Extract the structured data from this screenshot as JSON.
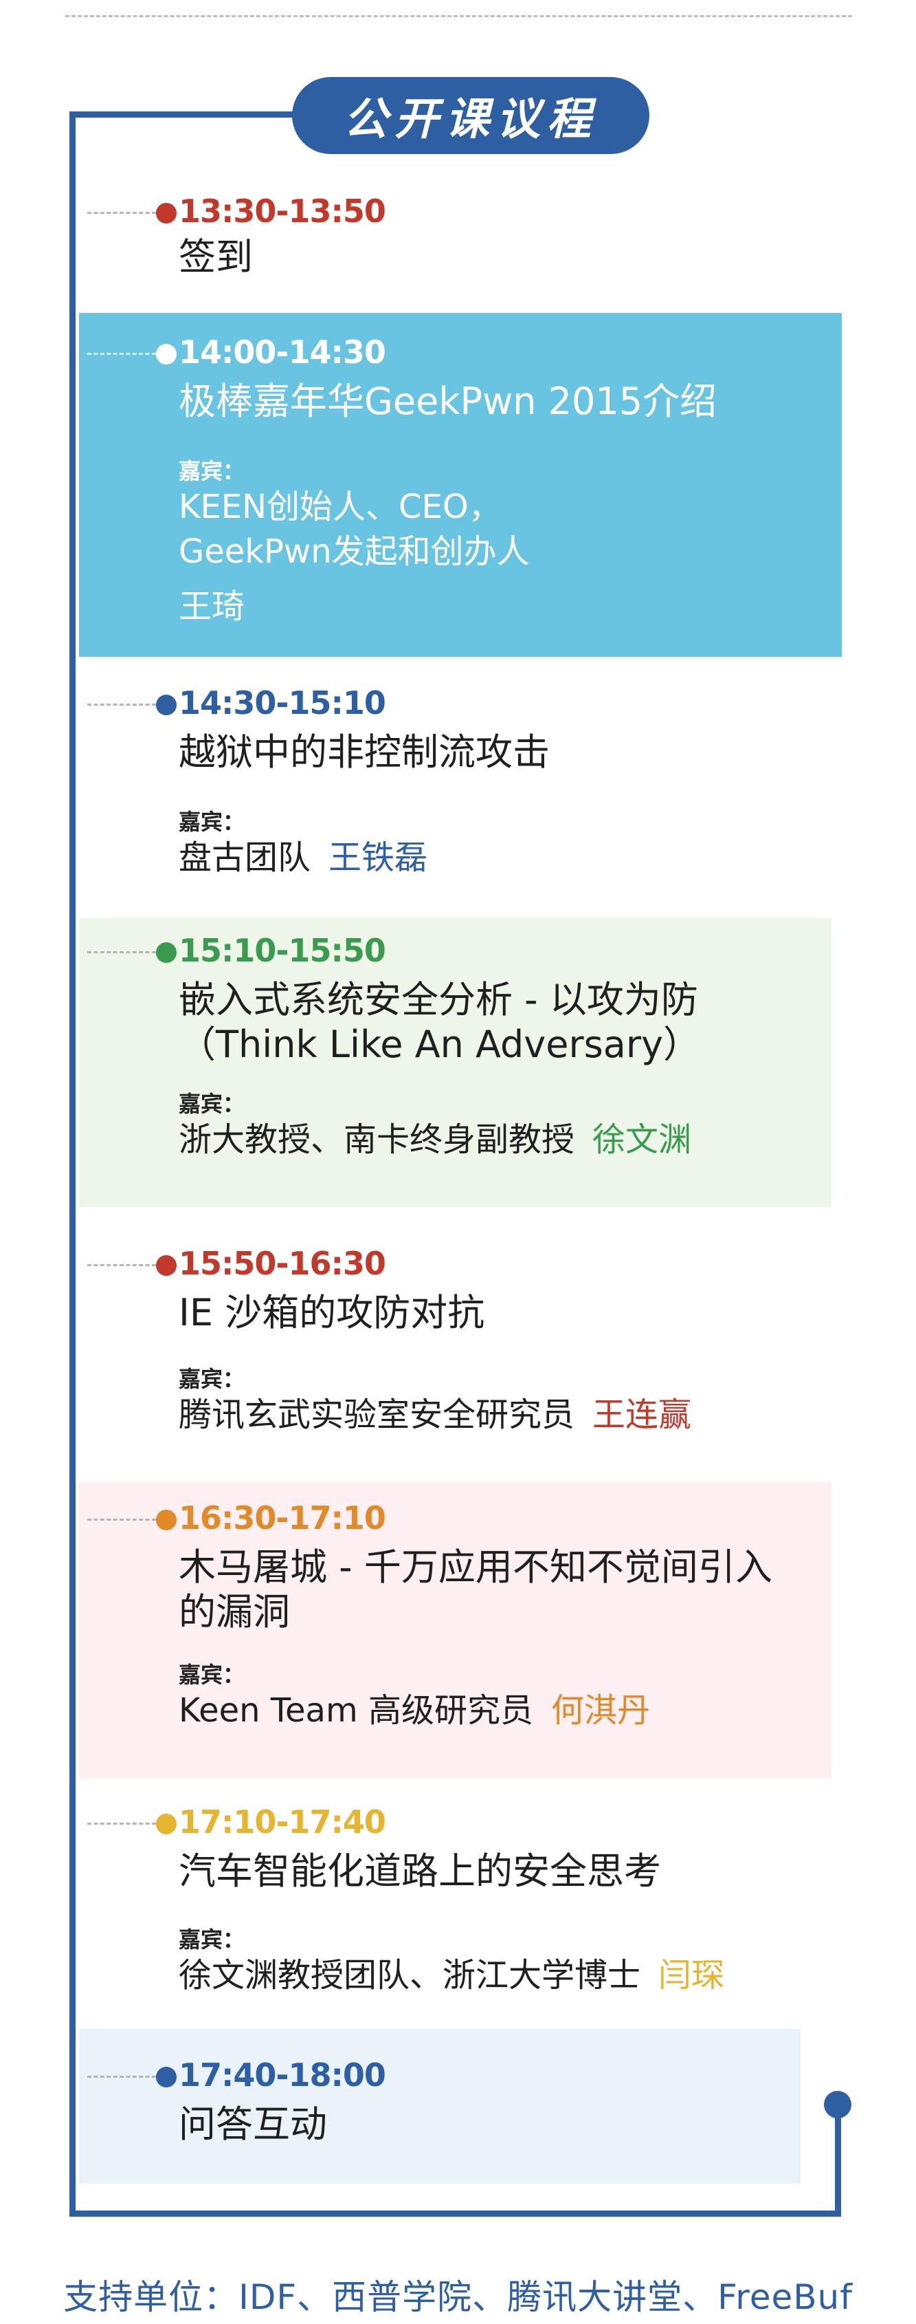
{
  "header": {
    "title": "公开课议程"
  },
  "sessions": [
    {
      "time": "13:30-13:50",
      "topic": "签到",
      "accent": "#c0392b"
    },
    {
      "time": "14:00-14:30",
      "topic": "极棒嘉年华GeekPwn 2015介绍",
      "guest_label": "嘉宾：",
      "guest_line1": "KEEN创始人、CEO，",
      "guest_line2": "GeekPwn发起和创办人",
      "guest_name": "王琦",
      "bg": "#68c4e0",
      "accent": "#ffffff"
    },
    {
      "time": "14:30-15:10",
      "topic": "越狱中的非控制流攻击",
      "guest_label": "嘉宾：",
      "guest_role": "盘古团队",
      "guest_name": "王铁磊",
      "accent": "#2f5fa3"
    },
    {
      "time": "15:10-15:50",
      "topic": "嵌入式系统安全分析 - 以攻为防",
      "topic2": "（Think Like An Adversary）",
      "guest_label": "嘉宾：",
      "guest_role": "浙大教授、南卡终身副教授",
      "guest_name": "徐文渊",
      "bg": "#eef6e9",
      "accent": "#3a9a4f"
    },
    {
      "time": "15:50-16:30",
      "topic": "IE 沙箱的攻防对抗",
      "guest_label": "嘉宾：",
      "guest_role": "腾讯玄武实验室安全研究员",
      "guest_name": "王连赢",
      "accent": "#c0392b"
    },
    {
      "time": "16:30-17:10",
      "topic": "木马屠城 - 千万应用不知不觉间引入",
      "topic2": "的漏洞",
      "guest_label": "嘉宾：",
      "guest_role": "Keen Team 高级研究员",
      "guest_name": "何淇丹",
      "bg": "#fdeff2",
      "accent": "#e08a2a"
    },
    {
      "time": "17:10-17:40",
      "topic": "汽车智能化道路上的安全思考",
      "guest_label": "嘉宾：",
      "guest_role": "徐文渊教授团队、浙江大学博士",
      "guest_name": "闫琛",
      "accent": "#e5b52f"
    },
    {
      "time": "17:40-18:00",
      "topic": "问答互动",
      "bg": "#eaf3fa",
      "accent": "#2f5fa3"
    }
  ],
  "footer": {
    "text": "支持单位：IDF、西普学院、腾讯大讲堂、FreeBuf"
  }
}
